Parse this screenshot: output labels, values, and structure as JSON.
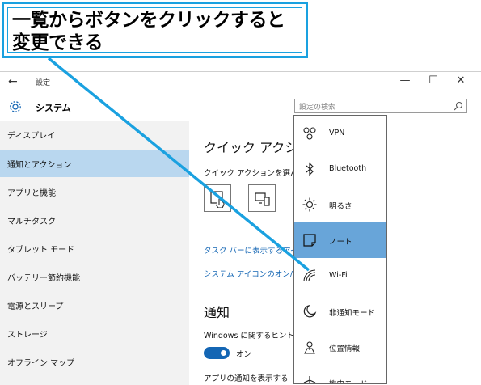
{
  "callout": {
    "line1": "一覧からボタンをクリックすると",
    "line2": "変更できる"
  },
  "window": {
    "title": "設定",
    "back_icon": "←",
    "controls": [
      "—",
      "☐",
      "✕"
    ]
  },
  "header": {
    "section_title": "システム",
    "search_placeholder": "設定の検索"
  },
  "sidebar": {
    "items": [
      {
        "label": "ディスプレイ"
      },
      {
        "label": "通知とアクション",
        "selected": true
      },
      {
        "label": "アプリと機能"
      },
      {
        "label": "マルチタスク"
      },
      {
        "label": "タブレット モード"
      },
      {
        "label": "バッテリー節約機能"
      },
      {
        "label": "電源とスリープ"
      },
      {
        "label": "ストレージ"
      },
      {
        "label": "オフライン マップ"
      }
    ]
  },
  "main": {
    "quick_actions_heading": "クイック アクション",
    "quick_actions_desc": "クイック アクションを選んで",
    "link_taskbar_icons": "タスク バーに表示するアイ",
    "link_system_icons": "システム アイコンのオン/オ",
    "notifications_heading": "通知",
    "windows_tips_text": "Windows に関するヒント",
    "toggle_state": "オン",
    "app_notifications_text": "アプリの通知を表示する"
  },
  "dropdown": {
    "items": [
      {
        "label": "VPN",
        "icon": "vpn-icon"
      },
      {
        "label": "Bluetooth",
        "icon": "bluetooth-icon"
      },
      {
        "label": "明るさ",
        "icon": "brightness-icon"
      },
      {
        "label": "ノート",
        "icon": "note-icon",
        "selected": true
      },
      {
        "label": "Wi-Fi",
        "icon": "wifi-icon"
      },
      {
        "label": "非通知モード",
        "icon": "quiet-hours-icon"
      },
      {
        "label": "位置情報",
        "icon": "location-icon"
      },
      {
        "label": "機内モード",
        "icon": "airplane-icon"
      }
    ]
  },
  "colors": {
    "accent": "#1466b4",
    "callout_border": "#1aa1e0",
    "sidebar_selected": "#b9d7ef",
    "dropdown_selected": "#68a5d9"
  }
}
